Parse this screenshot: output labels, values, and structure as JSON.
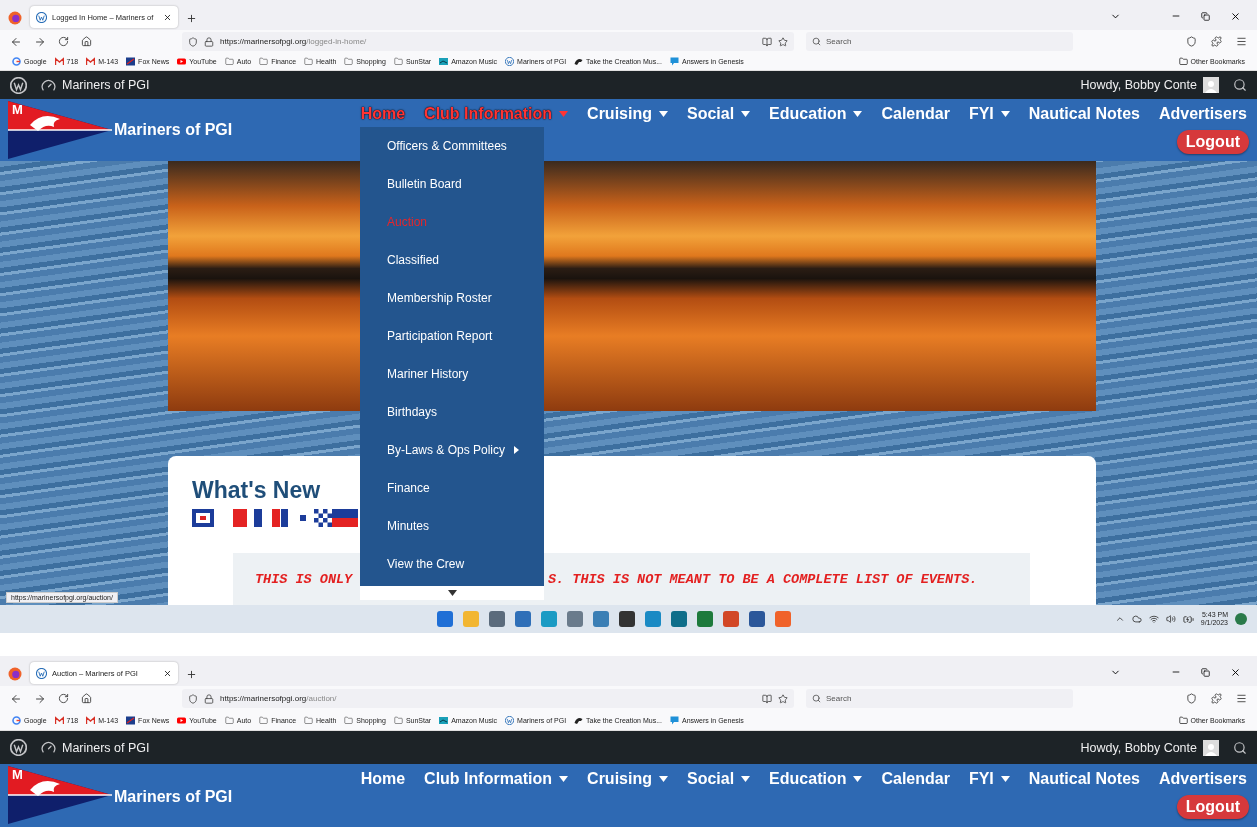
{
  "windows": [
    {
      "tabs": [
        {
          "title": "Logged In Home – Mariners of",
          "selected": true
        }
      ],
      "address": {
        "host": "https://marinersofpgi.org",
        "path": "/logged-in-home/"
      },
      "search": {
        "placeholder": "Search"
      },
      "bookmarks": [
        {
          "label": "Google",
          "kind": "google"
        },
        {
          "label": "718",
          "kind": "mail"
        },
        {
          "label": "M-143",
          "kind": "mail"
        },
        {
          "label": "Fox News",
          "kind": "news"
        },
        {
          "label": "YouTube",
          "kind": "video"
        },
        {
          "label": "Auto",
          "kind": "folder"
        },
        {
          "label": "Finance",
          "kind": "folder"
        },
        {
          "label": "Health",
          "kind": "folder"
        },
        {
          "label": "Shopping",
          "kind": "folder"
        },
        {
          "label": "SunStar",
          "kind": "folder"
        },
        {
          "label": "Amazon Music",
          "kind": "music"
        },
        {
          "label": "Mariners of PGI",
          "kind": "wordpress"
        },
        {
          "label": "Take the Creation Mus...",
          "kind": "creation"
        },
        {
          "label": "Answers in Genesis",
          "kind": "answers"
        }
      ],
      "other_bookmarks": "Other Bookmarks",
      "admin_bar": {
        "site": "Mariners of PGI",
        "greeting": "Howdy, Bobby Conte"
      },
      "header": {
        "logo_letter": "M",
        "site_title": "Mariners of PGI",
        "nav": [
          {
            "label": "Home",
            "highlighted": true,
            "dropdown": false
          },
          {
            "label": "Club Information",
            "highlighted": true,
            "dropdown": true
          },
          {
            "label": "Cruising",
            "highlighted": false,
            "dropdown": true
          },
          {
            "label": "Social",
            "highlighted": false,
            "dropdown": true
          },
          {
            "label": "Education",
            "highlighted": false,
            "dropdown": true
          },
          {
            "label": "Calendar",
            "highlighted": false,
            "dropdown": false
          },
          {
            "label": "FYI",
            "highlighted": false,
            "dropdown": true
          },
          {
            "label": "Nautical Notes",
            "highlighted": false,
            "dropdown": false
          },
          {
            "label": "Advertisers",
            "highlighted": false,
            "dropdown": false
          }
        ],
        "logout": "Logout"
      },
      "dropdown": {
        "items": [
          {
            "label": "Officers & Committees",
            "highlighted": false,
            "submenu": false
          },
          {
            "label": "Bulletin Board",
            "highlighted": false,
            "submenu": false
          },
          {
            "label": "Auction",
            "highlighted": true,
            "submenu": false
          },
          {
            "label": "Classified",
            "highlighted": false,
            "submenu": false
          },
          {
            "label": "Membership Roster",
            "highlighted": false,
            "submenu": false
          },
          {
            "label": "Participation Report",
            "highlighted": false,
            "submenu": false
          },
          {
            "label": "Mariner History",
            "highlighted": false,
            "submenu": false
          },
          {
            "label": "Birthdays",
            "highlighted": false,
            "submenu": false
          },
          {
            "label": "By-Laws & Ops Policy",
            "highlighted": false,
            "submenu": true
          },
          {
            "label": "Finance",
            "highlighted": false,
            "submenu": false
          },
          {
            "label": "Minutes",
            "highlighted": false,
            "submenu": false
          },
          {
            "label": "View the Crew",
            "highlighted": false,
            "submenu": false
          }
        ]
      },
      "content": {
        "heading": "What's New",
        "notice": [
          "THIS IS ONLY",
          "S. THIS IS NOT MEANT TO BE A COMPLETE LIST OF EVENTS."
        ]
      },
      "status_url": "https://marinersofpgi.org/auction/",
      "taskbar": {
        "time": "5:43 PM",
        "date": "9/1/2023"
      }
    },
    {
      "tabs": [
        {
          "title": "Auction – Mariners of PGI",
          "selected": true
        }
      ],
      "address": {
        "host": "https://marinersofpgi.org",
        "path": "/auction/"
      },
      "search": {
        "placeholder": "Search"
      },
      "bookmarks": [
        {
          "label": "Google",
          "kind": "google"
        },
        {
          "label": "718",
          "kind": "mail"
        },
        {
          "label": "M-143",
          "kind": "mail"
        },
        {
          "label": "Fox News",
          "kind": "news"
        },
        {
          "label": "YouTube",
          "kind": "video"
        },
        {
          "label": "Auto",
          "kind": "folder"
        },
        {
          "label": "Finance",
          "kind": "folder"
        },
        {
          "label": "Health",
          "kind": "folder"
        },
        {
          "label": "Shopping",
          "kind": "folder"
        },
        {
          "label": "SunStar",
          "kind": "folder"
        },
        {
          "label": "Amazon Music",
          "kind": "music"
        },
        {
          "label": "Mariners of PGI",
          "kind": "wordpress"
        },
        {
          "label": "Take the Creation Mus...",
          "kind": "creation"
        },
        {
          "label": "Answers in Genesis",
          "kind": "answers"
        }
      ],
      "other_bookmarks": "Other Bookmarks",
      "admin_bar": {
        "site": "Mariners of PGI",
        "greeting": "Howdy, Bobby Conte"
      },
      "header": {
        "logo_letter": "M",
        "site_title": "Mariners of PGI",
        "nav": [
          {
            "label": "Home",
            "highlighted": false,
            "dropdown": false
          },
          {
            "label": "Club Information",
            "highlighted": false,
            "dropdown": true
          },
          {
            "label": "Cruising",
            "highlighted": false,
            "dropdown": true
          },
          {
            "label": "Social",
            "highlighted": false,
            "dropdown": true
          },
          {
            "label": "Education",
            "highlighted": false,
            "dropdown": true
          },
          {
            "label": "Calendar",
            "highlighted": false,
            "dropdown": false
          },
          {
            "label": "FYI",
            "highlighted": false,
            "dropdown": true
          },
          {
            "label": "Nautical Notes",
            "highlighted": false,
            "dropdown": false
          },
          {
            "label": "Advertisers",
            "highlighted": false,
            "dropdown": false
          }
        ],
        "logout": "Logout"
      }
    }
  ]
}
